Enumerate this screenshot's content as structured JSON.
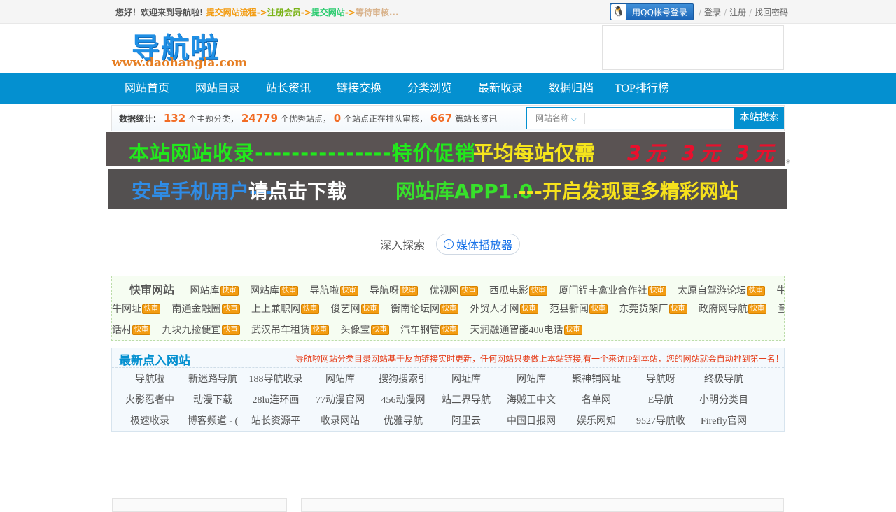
{
  "topbar": {
    "welcome": "您好！欢迎来到导航啦!",
    "steps": [
      "提交网站流程",
      "注册会员",
      "提交网站",
      "等待审核..."
    ],
    "arrow": "->",
    "qq_login": "用QQ帐号登录",
    "links": [
      "登录",
      "注册",
      "找回密码"
    ],
    "sep": "/"
  },
  "logo": {
    "text": "导航啦",
    "url_text": "www.daohangla.com"
  },
  "nav": [
    "网站首页",
    "网站目录",
    "站长资讯",
    "链接交换",
    "分类浏览",
    "最新收录",
    "数据归档",
    "TOP排行榜"
  ],
  "stats": {
    "label": "数据统计：",
    "categories": "132",
    "categories_text": "个主题分类，",
    "sites": "24779",
    "sites_text": "个优秀站点，",
    "pending": "0",
    "pending_text": "个站点正在排队审核，",
    "articles": "667",
    "articles_text": "篇站长资讯"
  },
  "search": {
    "select": "网站名称",
    "placeholder": "",
    "button": "本站搜索"
  },
  "banner1": {
    "t1": "本站网站收录---------------特价促销",
    "t2": "平均每站仅需",
    "t3": "3元 3元 3元"
  },
  "banner_star": "*",
  "banner2": {
    "t1": "安卓手机用户---",
    "t2": "请点击下载",
    "t3": "网站库APP1.0",
    "t4": "---开启发现更多精彩网站"
  },
  "explore": {
    "label": "深入探索",
    "pill": "媒体播放器"
  },
  "quick": {
    "title": "快审网站",
    "badge": "快审",
    "row1": [
      "网站库",
      "网站库",
      "导航啦",
      "导航呀",
      "优视网",
      "西瓜电影",
      "厦门锃丰禽业合作社",
      "太原自驾游论坛",
      "牛"
    ],
    "row2_lead": "牛网址",
    "row2": [
      "南通金融圈",
      "上上兼职网",
      "俊艺网",
      "衡南论坛网",
      "外贸人才网",
      "范县新闻",
      "东莞货架厂",
      "政府网导航",
      "童"
    ],
    "row3_lead": "话村",
    "row3": [
      "九块九捡便宜",
      "武汉吊车租赁",
      "头像宝",
      "汽车钢管",
      "天润融通智能400电话"
    ]
  },
  "latest": {
    "title": "最新点入网站",
    "notice": "导航啦网站分类目录网站基于反向链接实时更新，任何网站只要做上本站链接,有一个来访IP到本站，您的网站就会自动排到第一名！",
    "rows": [
      [
        "导航啦",
        "新迷路导航",
        "188导航收录",
        "网站库",
        "搜狗搜索引",
        "网址库",
        "网站库",
        "聚神铺网址",
        "导航呀",
        "终极导航"
      ],
      [
        "火影忍者中",
        "动漫下载",
        "28lu连环画",
        "77动漫官网",
        "456动漫网",
        "站三界导航",
        "海贼王中文",
        "名单网",
        "E导航",
        "小明分类目"
      ],
      [
        "极速收录",
        "博客频道 - (",
        "站长资源平",
        "收录网站",
        "优雅导航",
        "阿里云",
        "中国日报网",
        "娱乐网知",
        "9527导航收",
        "Firefly官网"
      ]
    ]
  }
}
